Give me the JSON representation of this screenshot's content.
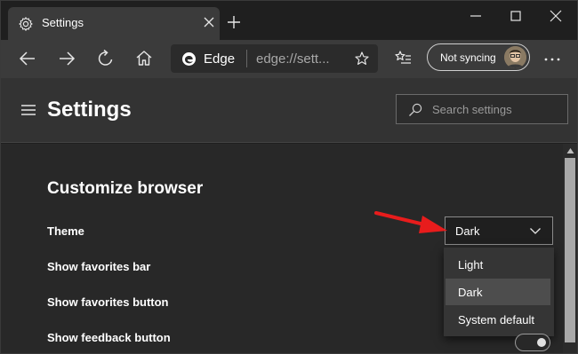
{
  "tab": {
    "title": "Settings"
  },
  "address": {
    "host": "Edge",
    "url": "edge://sett..."
  },
  "sync": {
    "label": "Not syncing"
  },
  "header": {
    "title": "Settings",
    "search_placeholder": "Search settings"
  },
  "section": {
    "title": "Customize browser",
    "rows": [
      {
        "label": "Theme"
      },
      {
        "label": "Show favorites bar"
      },
      {
        "label": "Show favorites button"
      },
      {
        "label": "Show feedback button"
      }
    ]
  },
  "theme_select": {
    "value": "Dark",
    "options": [
      "Light",
      "Dark",
      "System default"
    ]
  },
  "feedback_toggle": {
    "state": "off"
  },
  "colors": {
    "accent_arrow": "#e81c1c",
    "window_bg": "#1f1f1f",
    "toolbar_bg": "#3b3b3b",
    "content_bg": "#282828"
  }
}
